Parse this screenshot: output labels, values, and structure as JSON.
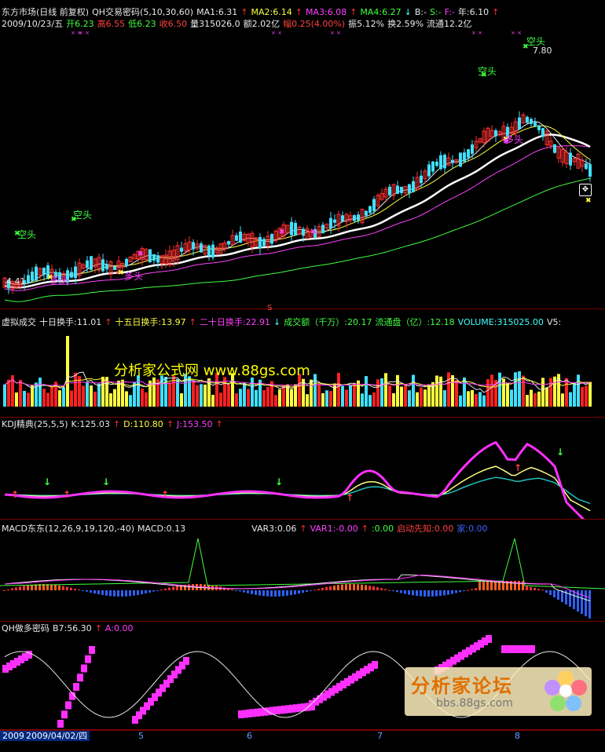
{
  "main": {
    "line1": {
      "market": "东方市场(日线 前复权)",
      "indicator": "QH交易密码(5,10,30,60)",
      "ma1": "MA1:6.31",
      "ma2": "MA2:6.14",
      "ma3": "MA3:6.08",
      "ma4": "MA4:6.27",
      "b": "B:-",
      "s": "S:-",
      "f": "F:-",
      "year": "年:6.10"
    },
    "line2": {
      "date": "2009/10/23/五",
      "open": "开6.23",
      "high": "高6.55",
      "low": "低6.23",
      "close": "收6.50",
      "volume": "量315026.0",
      "amount": "额2.02亿",
      "change": "幅0.25(4.00%)",
      "amplitude": "振5.12%",
      "turnover": "换2.59%",
      "float": "流通12.2亿"
    },
    "labels": {
      "kong1": "空头",
      "kong2": "空头",
      "kong3": "空头",
      "kong4": "空头",
      "duo1": "多头",
      "duo2": "多头",
      "duo3": "多头",
      "peak": "7.80",
      "low_value": "4.41",
      "s_marker": "S"
    }
  },
  "volume": {
    "name": "虚拟成交",
    "t10": "十日换手:11.01",
    "t15": "十五日换手:13.97",
    "t20": "二十日换手:22.91",
    "amount": "成交额（千万）:20.17",
    "float": "流通盘（亿）:12.18",
    "vol": "VOLUME:315025.00",
    "v5": "V5:"
  },
  "kdj": {
    "name": "KDJ精典(25,5,5)",
    "k": "K:125.03",
    "d": "D:110.80",
    "j": "J:153.50"
  },
  "macd": {
    "name": "MACD东东(12,26,9,19,120,-40)",
    "macd": "MACD:0.13",
    "var3": "VAR3:0.06",
    "var1": "VAR1:-0.00",
    "zero": ":0.00",
    "qidong": "启动先知:0.00",
    "last": "家:0.00"
  },
  "qh": {
    "name": "QH做多密码",
    "b7": "B7:56.30",
    "a": "A:0.00"
  },
  "watermarks": {
    "center": "分析家公式网 www.88gs.com",
    "logo_text": "分析家论坛",
    "logo_url": "bbs.88gs.com"
  },
  "bottom": {
    "date_left": "2009",
    "date_chip": "2009/04/02/四",
    "ticks": [
      "5",
      "6",
      "7",
      "8"
    ]
  },
  "colors": {
    "up": "#ff3030",
    "down": "#40e0ff",
    "ma1": "#e8e8e8",
    "ma2": "#ffff40",
    "ma3": "#ff40ff",
    "ma4": "#40ff40",
    "panel_border": "#7a0000"
  }
}
